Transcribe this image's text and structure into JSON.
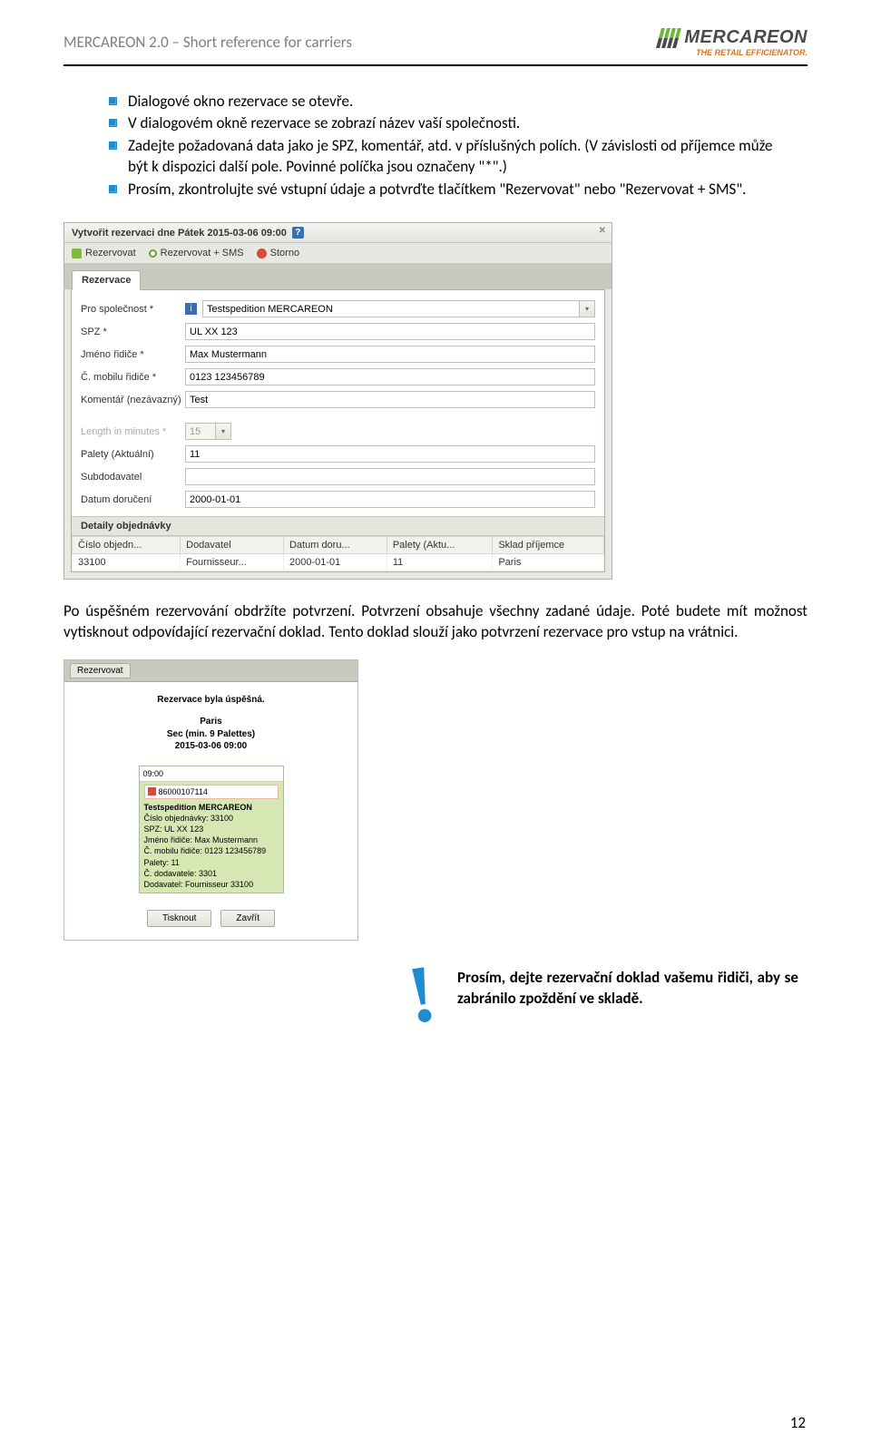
{
  "header": {
    "title": "MERCAREON 2.0 – Short reference for carriers",
    "logo_text": "MERCAREON",
    "logo_tagline": "THE RETAIL EFFICIENATOR."
  },
  "bullets": [
    "Dialogové okno rezervace se otevře.",
    "V dialogovém okně rezervace se zobrazí název vaší společnosti.",
    "Zadejte požadovaná data jako je SPZ, komentář, atd. v příslušných polích. (V závislosti od příjemce může být k dispozici další pole. Povinné políčka jsou označeny \"*\".)",
    "Prosím, zkontrolujte své vstupní údaje a potvrďte tlačítkem \"Rezervovat\" nebo \"Rezervovat + SMS\"."
  ],
  "form": {
    "window_title": "Vytvořit rezervaci dne Pátek 2015-03-06 09:00",
    "toolbar": {
      "reserve": "Rezervovat",
      "reserve_sms": "Rezervovat + SMS",
      "cancel": "Storno"
    },
    "tab": "Rezervace",
    "fields": {
      "company_label": "Pro společnost *",
      "company_value": "Testspedition MERCAREON",
      "spz_label": "SPZ *",
      "spz_value": "UL XX 123",
      "driver_label": "Jméno řidiče *",
      "driver_value": "Max Mustermann",
      "phone_label": "Č. mobilu řidiče *",
      "phone_value": "0123 123456789",
      "comment_label": "Komentář (nezávazný)",
      "comment_value": "Test",
      "length_label": "Length in minutes *",
      "length_value": "15",
      "pallets_label": "Palety (Aktuální)",
      "pallets_value": "11",
      "sub_label": "Subdodavatel",
      "sub_value": "",
      "delivery_label": "Datum doručení",
      "delivery_value": "2000-01-01"
    },
    "order_section": "Detaily objednávky",
    "order_table": {
      "headers": [
        "Číslo objedn...",
        "Dodavatel",
        "Datum doru...",
        "Palety (Aktu...",
        "Sklad příjemce"
      ],
      "row": [
        "33100",
        "Fournisseur...",
        "2000-01-01",
        "11",
        "Paris"
      ]
    }
  },
  "paragraph_after": "Po úspěšném rezervování obdržíte potvrzení. Potvrzení obsahuje všechny zadané údaje. Poté budete mít možnost vytisknout odpovídající rezervační doklad. Tento doklad slouží jako potvrzení rezervace pro vstup na vrátnici.",
  "confirm": {
    "tab": "Rezervovat",
    "success_title": "Rezervace byla úspěšná.",
    "meta_location": "Paris",
    "meta_line": "Sec (min. 9 Palettes)",
    "meta_datetime": "2015-03-06 09:00",
    "time_header": "09:00",
    "id": "86000107114",
    "details": [
      "Testspedition MERCAREON",
      "Číslo objednávky: 33100",
      "SPZ: UL XX 123",
      "Jméno řidiče: Max Mustermann",
      "Č. mobilu řidiče: 0123 123456789",
      "Palety: 11",
      "Č. dodavatele: 3301",
      "Dodavatel: Fournisseur 33100"
    ],
    "btn_print": "Tisknout",
    "btn_close": "Zavřít"
  },
  "tip": "Prosím, dejte rezervační doklad vašemu řidiči, aby se zabránilo zpoždění ve skladě.",
  "page_num": "12"
}
